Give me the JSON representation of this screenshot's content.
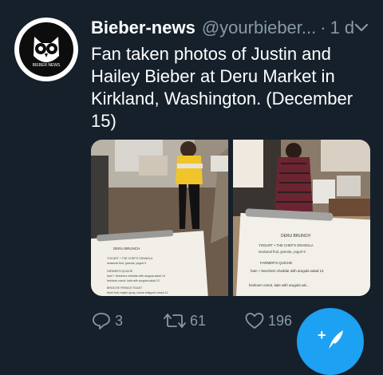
{
  "tweet": {
    "author_name": "Bieber-news",
    "handle": "@yourbieber...",
    "separator": "·",
    "time": "1 d",
    "text": "Fan taken photos of Justin and Hailey Bieber at Deru Market in Kirkland, Washington. (December 15)",
    "avatar_icon": "owl-logo-icon",
    "avatar_label": "BIEBER NEWS"
  },
  "photos": [
    {
      "menu_title": "DERU BRUNCH",
      "menu_lines": [
        "YOGURT + THE CHEF'S GRANOLA",
        "seasonal fruit, granola, yogurt 9",
        "FARMER'S QUICHE",
        "ham + beechers cheddar with arugula salad 13",
        "heirloom carrot, kale with arugula salad 13",
        "BRIOCHE FRENCH TOAST",
        "fresh fruit, maple syrup, house whipped cream 11"
      ]
    },
    {
      "menu_title": "DERU BRUNCH",
      "menu_lines": [
        "YOGURT + THE CHEF'S GRANOLA",
        "seasonal fruit, granola, yogurt 9",
        "FARMER'S QUICHE",
        "ham + beechers cheddar with arugula salad 13",
        "heirloom carrot, kale with arugula sal..."
      ]
    }
  ],
  "actions": {
    "reply_count": "3",
    "retweet_count": "61",
    "like_count": "196",
    "reply_icon": "reply-icon",
    "retweet_icon": "retweet-icon",
    "like_icon": "heart-icon"
  },
  "fab": {
    "icon": "compose-feather-icon",
    "plus": "+"
  },
  "colors": {
    "background": "#15202b",
    "muted": "#8899a6",
    "accent": "#1da1f2"
  }
}
